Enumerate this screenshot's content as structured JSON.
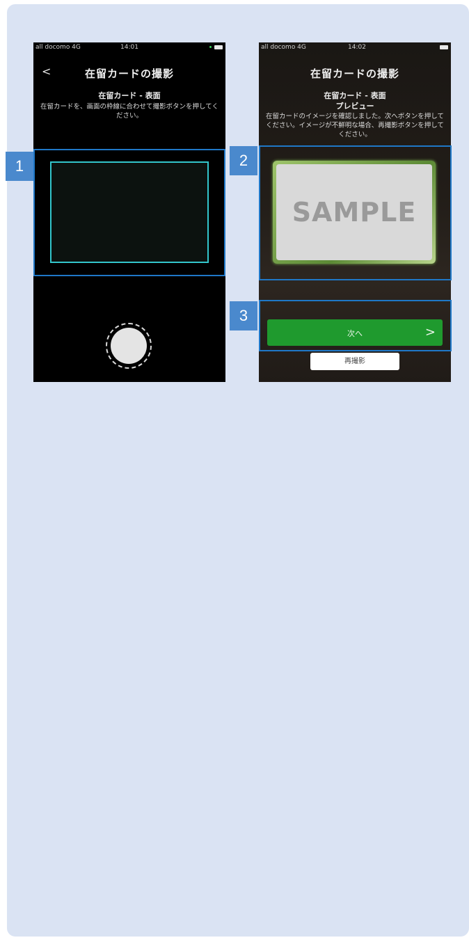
{
  "phone1": {
    "status": {
      "carrier": "all docomo 4G",
      "time": "14:01"
    },
    "back": "<",
    "title": "在留カードの撮影",
    "subtitle": "在留カード - 表面",
    "instruction": "在留カードを、画面の枠線に合わせて撮影ボタンを押してください。"
  },
  "phone2": {
    "status": {
      "carrier": "all docomo 4G",
      "time": "14:02"
    },
    "title": "在留カードの撮影",
    "subtitle": "在留カード - 表面",
    "subtitle2": "プレビュー",
    "instruction": "在留カードのイメージを確認しました。次へボタンを押してください。イメージが不鮮明な場合、再撮影ボタンを押してください。",
    "sample_label": "SAMPLE",
    "next_button": "次へ",
    "next_chevron": ">",
    "retake_button": "再撮影"
  },
  "badges": {
    "one": "1",
    "two": "2",
    "three": "3"
  },
  "colors": {
    "panel": "#dae3f3",
    "badge": "#4a89cd",
    "highlight": "#1f78c8",
    "next_button": "#1f9a2e",
    "frame": "#33c6cc"
  }
}
